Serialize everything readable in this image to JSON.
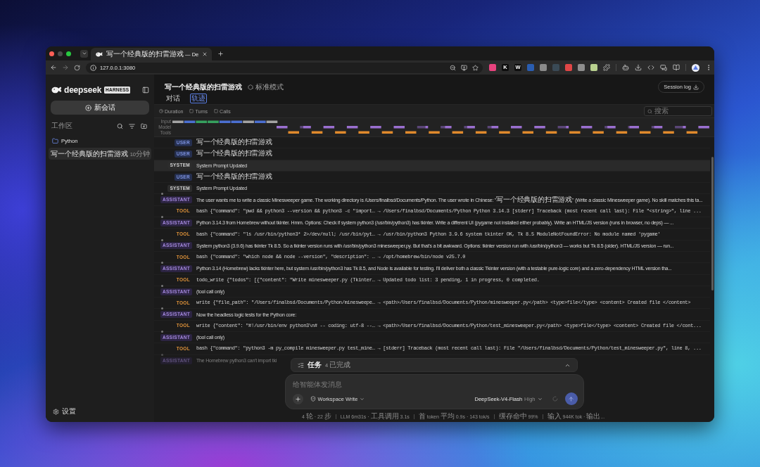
{
  "browser": {
    "tabs": [
      {
        "title": "写一个经典版的扫雷游戏 — De",
        "selected": true
      }
    ],
    "address": "127.0.0.1:3080",
    "extensions": [
      {
        "color": "#e8437e"
      },
      {
        "label": "K",
        "color": "#0d0d0d"
      },
      {
        "label": "W",
        "color": "#0d0d0d"
      },
      {
        "color": "#2a5db0"
      },
      {
        "color": "#8a8a8a"
      },
      {
        "color": "#3a4a56"
      },
      {
        "color": "#e04646"
      },
      {
        "color": "#8e8e8e"
      },
      {
        "color": "#b9d18f"
      }
    ]
  },
  "sidebar": {
    "brand": "deepseek",
    "tag": "HARNESS",
    "new_chat": "新会话",
    "workspace_label": "工作区",
    "folders": [
      {
        "name": "Python",
        "children": [
          {
            "title": "写一个经典版的扫雷游戏",
            "time": "10分钟",
            "selected": true
          }
        ]
      }
    ],
    "settings": "设置"
  },
  "header": {
    "title": "写一个经典版的扫雷游戏",
    "mode": "标准模式",
    "session_log": "Session log",
    "tabs": [
      {
        "label": "对话",
        "selected": false
      },
      {
        "label": "轨迹",
        "selected": true
      }
    ]
  },
  "filters": {
    "options": [
      "Duration",
      "Turns",
      "Calls"
    ],
    "search": {
      "placeholder": "搜索"
    }
  },
  "timeline": {
    "lanes": [
      "Input",
      "Model",
      "Tools"
    ]
  },
  "log": {
    "rows": [
      {
        "kind": "user",
        "badge": "USER",
        "text": "写一个经典版的扫雷游戏",
        "selected": false
      },
      {
        "kind": "user",
        "badge": "USER",
        "text": "写一个经典版的扫雷游戏",
        "selected": false
      },
      {
        "kind": "system",
        "badge": "SYSTEM",
        "text": "System Prompt Updated",
        "selected": true
      },
      {
        "kind": "user",
        "badge": "USER",
        "text": "写一个经典版的扫雷游戏",
        "selected": false
      },
      {
        "kind": "system",
        "badge": "SYSTEM",
        "text": "System Prompt Updated",
        "selected": false
      },
      {
        "kind": "assistant",
        "badge": "ASSISTANT",
        "text": "The user wants me to write a classic Minesweeper game. The working directory is /Users/finalbsd/Documents/Python. The user wrote in Chinese: \"写一个经典版的扫雷游戏\" (Write a classic Minesweeper game). No skill matches this ta...",
        "selected": false
      },
      {
        "kind": "tool",
        "badge": "TOOL",
        "text": "bash {\"command\": \"pwd && python3 --version && python3 -c \"import… → /Users/finalbsd/Documents/Python Python 3.14.3 [stderr] Traceback (most recent call last): File \"<string>\", line ...",
        "selected": false
      },
      {
        "kind": "assistant",
        "badge": "ASSISTANT",
        "text": "Python 3.14.3 from Homebrew without tkinter. Hmm. Options: Check if system python3 (/usr/bin/python3) has tkinter. Write a different UI (pygame not installed either probably). Write an HTML/JS version (runs in browser, no deps) — ...",
        "selected": false
      },
      {
        "kind": "tool",
        "badge": "TOOL",
        "text": "bash {\"command\": \"ls /usr/bin/python3* 2>/dev/null; /usr/bin/pyt… → /usr/bin/python3 Python 3.9.6 system tkinter OK, Tk 8.5 ModuleNotFoundError: No module named 'pygame'",
        "selected": false
      },
      {
        "kind": "assistant",
        "badge": "ASSISTANT",
        "text": "System python3 (3.9.6) has tkinter Tk 8.5. So a tkinter version runs with /usr/bin/python3 minesweeper.py. But that's a bit awkward. Options: tkinter version run with /usr/bin/python3 — works but Tk 8.5 (older). HTML/JS version — run...",
        "selected": false
      },
      {
        "kind": "tool",
        "badge": "TOOL",
        "text": "bash {\"command\": \"which node && node --version\", \"description\": … → /opt/homebrew/bin/node v25.7.0",
        "selected": false
      },
      {
        "kind": "assistant",
        "badge": "ASSISTANT",
        "text": "Python 3.14 (Homebrew) lacks tkinter here, but system /usr/bin/python3 has Tk 8.5, and Node is available for testing. I'll deliver both a classic Tkinter version (with a testable pure-logic core) and a zero-dependency HTML version tha...",
        "selected": false
      },
      {
        "kind": "tool",
        "badge": "TOOL",
        "text": "todo_write {\"todos\": [{\"content\": \"Write minesweeper.py (Tkinter… → Updated todo list: 3 pending, 1 in progress, 0 completed.",
        "selected": false
      },
      {
        "kind": "assistant",
        "badge": "ASSISTANT",
        "text": "(tool call only)",
        "selected": false
      },
      {
        "kind": "tool",
        "badge": "TOOL",
        "text": "write {\"file_path\": \"/Users/finalbsd/Documents/Python/minesweepe… → <path>/Users/finalbsd/Documents/Python/minesweeper.py</path> <type>file</type> <content> Created file </content>",
        "selected": false
      },
      {
        "kind": "assistant",
        "badge": "ASSISTANT",
        "text": "Now the headless logic tests for the Python core:",
        "selected": false
      },
      {
        "kind": "tool",
        "badge": "TOOL",
        "text": "write {\"content\": \"#!/usr/bin/env python3\\n# -- coding: utf-8 --… → <path>/Users/finalbsd/Documents/Python/test_minesweeper.py</path> <type>file</type> <content> Created file </cont...",
        "selected": false
      },
      {
        "kind": "assistant",
        "badge": "ASSISTANT",
        "text": "(tool call only)",
        "selected": false
      },
      {
        "kind": "tool",
        "badge": "TOOL",
        "text": "bash {\"command\": \"python3 -m py_compile minesweeper.py test_mine… → [stderr] Traceback (most recent call last): File \"/Users/finalbsd/Documents/Python/test_minesweeper.py\", line 8, ...",
        "selected": false
      },
      {
        "kind": "assistant",
        "badge": "ASSISTANT",
        "text": "The Homebrew python3 can't import tki",
        "selected": false
      }
    ]
  },
  "tasks": {
    "label": "任务",
    "status": "4 已完成",
    "expanded": false
  },
  "composer": {
    "placeholder": "给智能体发消息",
    "permission": "Workspace Write",
    "model": "DeepSeek-V4-Flash",
    "effort": "High"
  },
  "status_bar": [
    "4 轮 · 22 步",
    "LLM 6m31s · 工具调用 3.1s",
    "首 token 平均 0.9s · 143 tok/s",
    "缓存命中 99%",
    "输入 944K tok · 输出..."
  ]
}
